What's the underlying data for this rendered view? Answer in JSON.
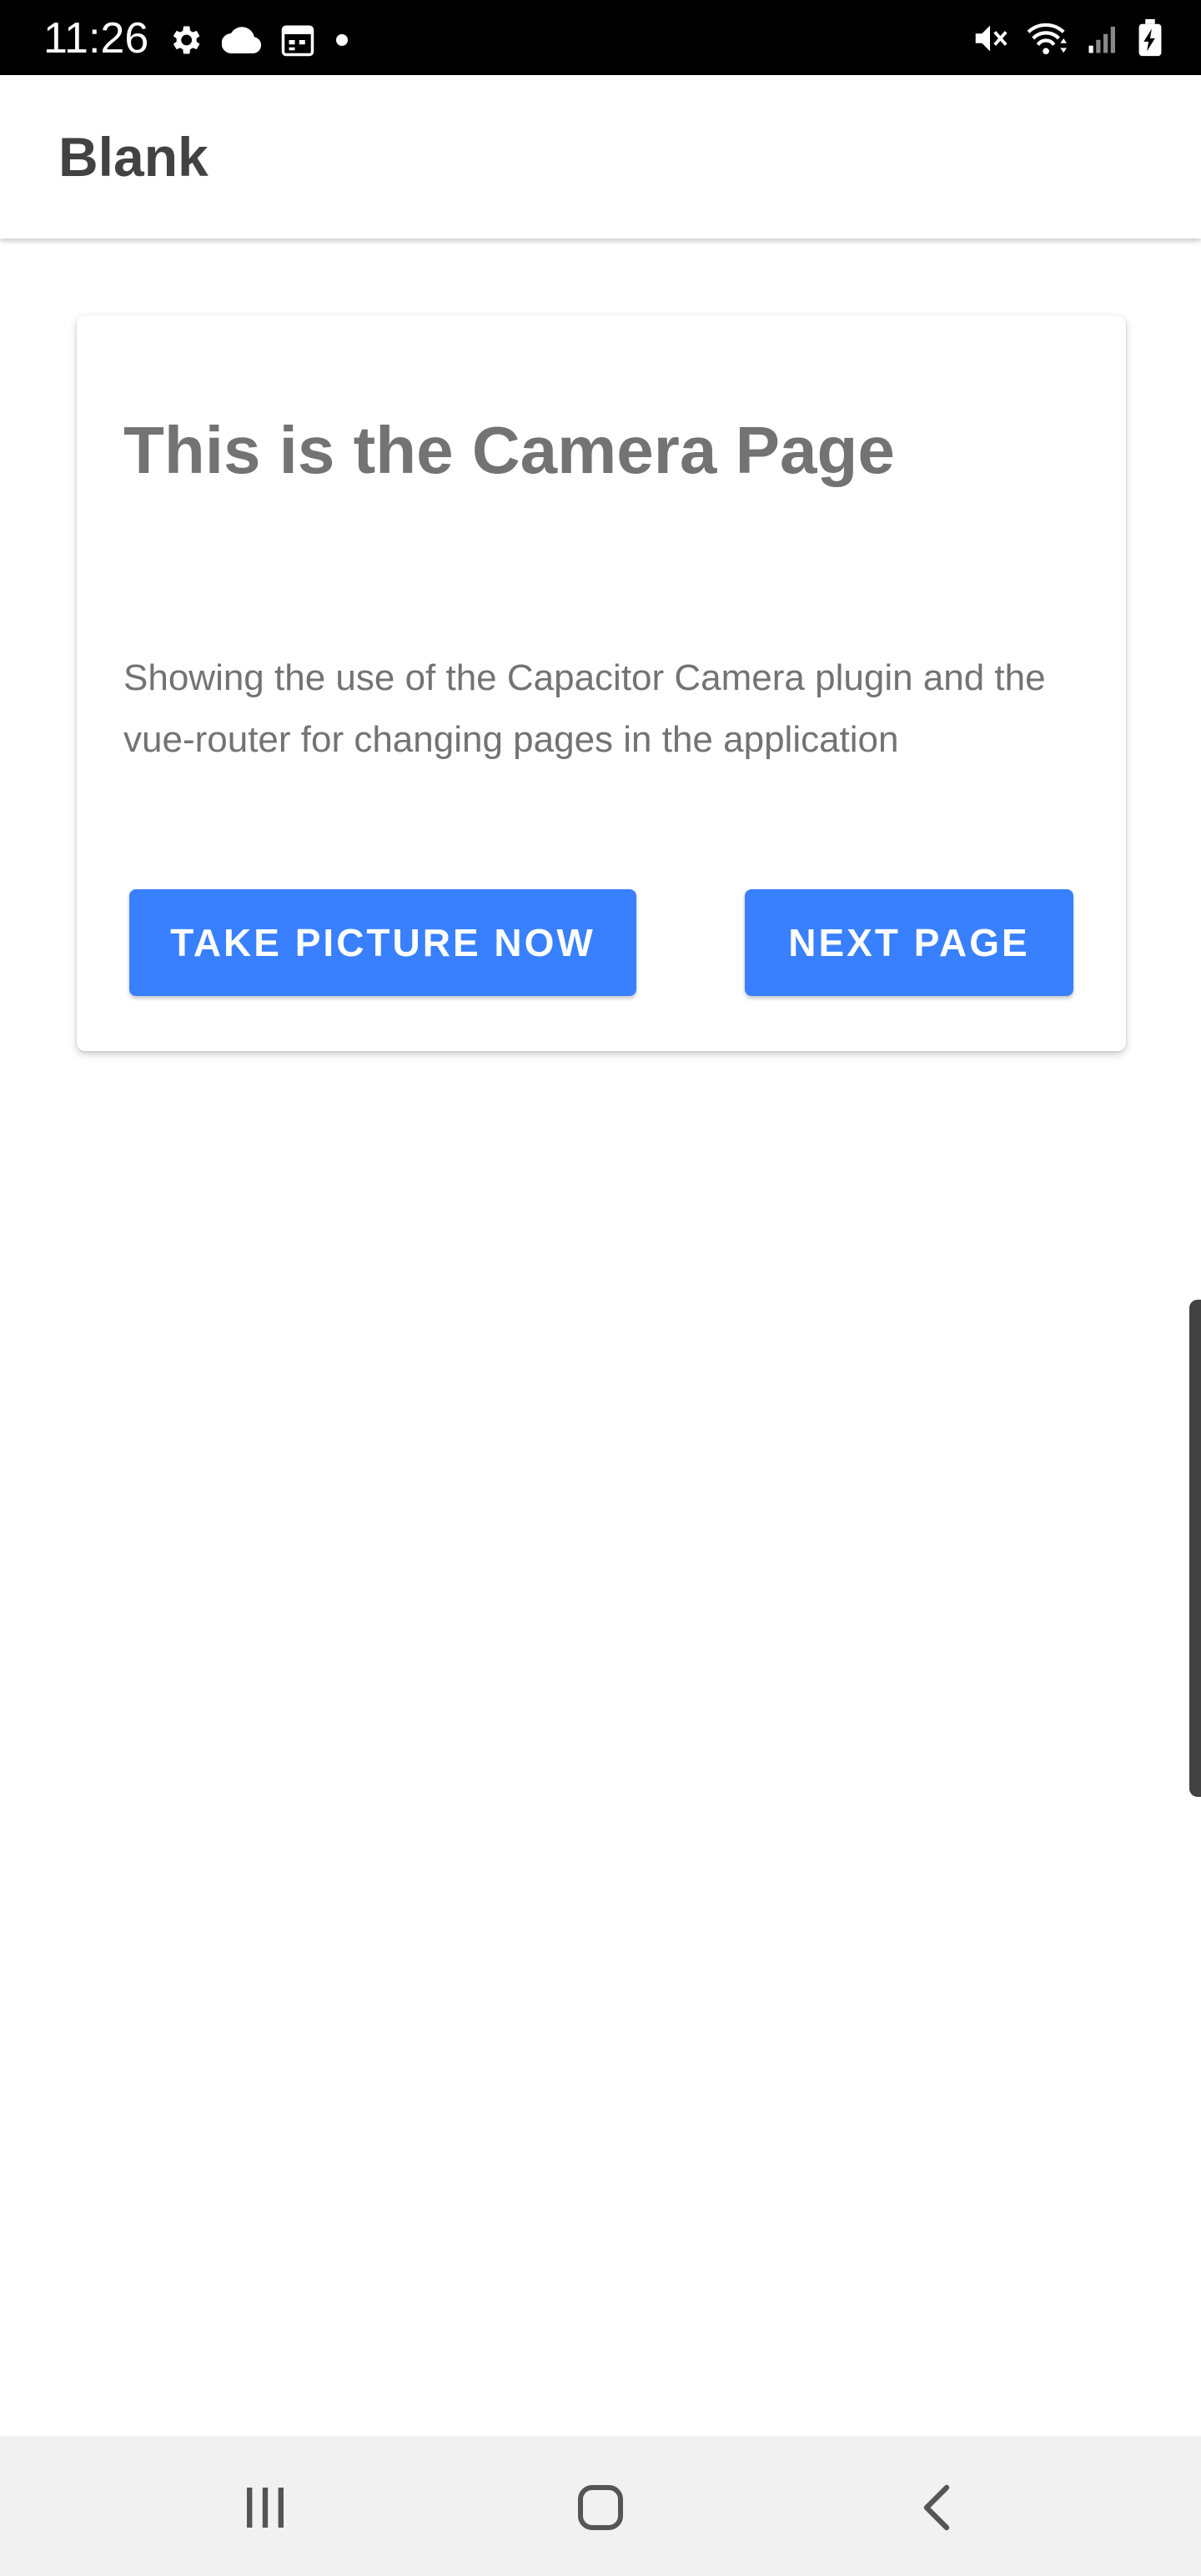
{
  "status_bar": {
    "time": "11:26",
    "left_icons": [
      "gear-icon",
      "cloud-icon",
      "calendar-icon",
      "dot-icon"
    ],
    "right_icons": [
      "mute-icon",
      "wifi-icon",
      "signal-icon",
      "battery-charging-icon"
    ]
  },
  "toolbar": {
    "title": "Blank"
  },
  "card": {
    "title": "This is the Camera Page",
    "description": "Showing the use of the Capacitor Camera plugin and the vue-router for changing pages in the application",
    "take_picture_label": "TAKE PICTURE NOW",
    "next_page_label": "NEXT PAGE"
  },
  "nav_bar": {
    "buttons": [
      "recents-icon",
      "home-icon",
      "back-icon"
    ]
  },
  "colors": {
    "primary": "#3880ff",
    "status_bar": "#000000",
    "nav_bar": "#f1f1f1",
    "text_dark": "#424242",
    "text_muted": "#737373"
  }
}
